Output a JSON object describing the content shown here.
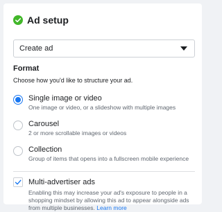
{
  "header": {
    "title": "Ad setup"
  },
  "colors": {
    "accent": "#1877f2",
    "success": "#42b72a"
  },
  "icons": {
    "header": "check-circle-icon",
    "dropdown": "caret-down-icon",
    "checkbox": "checkmark-icon"
  },
  "select": {
    "value": "Create ad"
  },
  "format": {
    "title": "Format",
    "subtitle": "Choose how you'd like to structure your ad.",
    "options": [
      {
        "label": "Single image or video",
        "description": "One image or video, or a slideshow with multiple images",
        "selected": true
      },
      {
        "label": "Carousel",
        "description": "2 or more scrollable images or videos",
        "selected": false
      },
      {
        "label": "Collection",
        "description": "Group of items that opens into a fullscreen mobile experience",
        "selected": false
      }
    ]
  },
  "multi_advertiser": {
    "label": "Multi-advertiser ads",
    "checked": true,
    "description": "Enabling this may increase your ad's exposure to people in a shopping mindset by allowing this ad to appear alongside ads from multiple businesses.",
    "link_text": "Learn more"
  }
}
